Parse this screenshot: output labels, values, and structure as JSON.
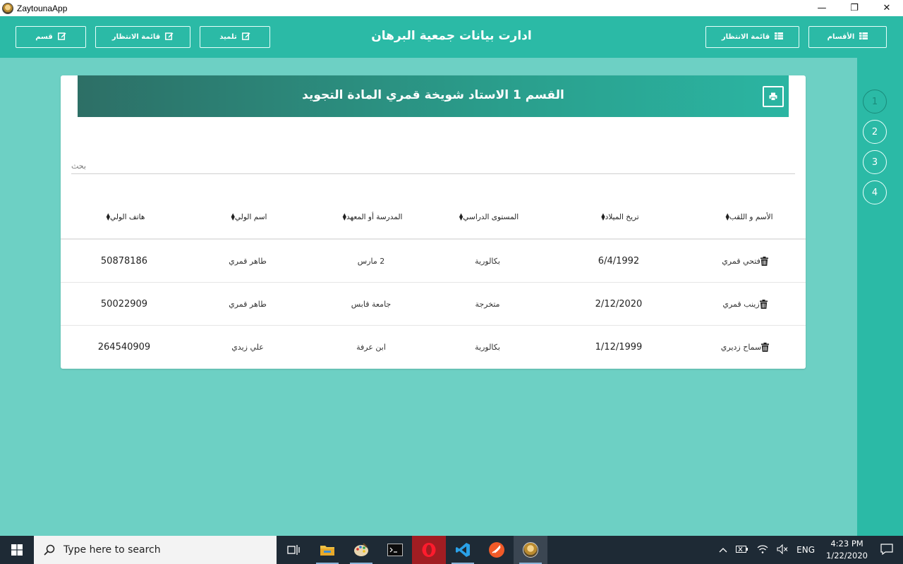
{
  "window": {
    "title": "ZaytounaApp",
    "minimize": "—",
    "maximize": "❐",
    "close": "✕"
  },
  "header": {
    "title": "ادارت بيانات جمعية البرهان",
    "right_buttons": [
      {
        "label": "الأقسام",
        "icon": "table-icon"
      },
      {
        "label": "قائمة الانتظار",
        "icon": "table-icon"
      }
    ],
    "left_buttons": [
      {
        "label": "تلميد",
        "icon": "edit-icon"
      },
      {
        "label": "قائمة الانتظار",
        "icon": "edit-icon"
      },
      {
        "label": "قسم",
        "icon": "edit-icon"
      }
    ]
  },
  "pagination": [
    "1",
    "2",
    "3",
    "4"
  ],
  "card": {
    "title": "القسم 1 الاستاد شويخة قمري المادة التجويد",
    "search_placeholder": "بحث"
  },
  "table": {
    "columns": [
      "الأسم و اللقب",
      "تريخ الميلاد",
      "المستوى الدراسي",
      "المدرسة أو المعهد",
      "اسم الولي",
      "هاتف الولي"
    ],
    "rows": [
      {
        "name": "فتحي قمري",
        "birth": "6/4/1992",
        "level": "بكالورية",
        "school": "2 مارس",
        "guardian": "طاهر قمري",
        "phone": "50878186"
      },
      {
        "name": "زينب قمري",
        "birth": "2/12/2020",
        "level": "متخرجة",
        "school": "جامعة قابس",
        "guardian": "طاهر قمري",
        "phone": "50022909"
      },
      {
        "name": "سماح زديري",
        "birth": "1/12/1999",
        "level": "بكالورية",
        "school": "ابن عرفة",
        "guardian": "علي زيدي",
        "phone": "264540909"
      }
    ]
  },
  "taskbar": {
    "search_placeholder": "Type here to search",
    "language": "ENG",
    "time": "4:23 PM",
    "date": "1/22/2020"
  },
  "colors": {
    "primary": "#2bbaa6",
    "background": "#6dd0c4"
  }
}
